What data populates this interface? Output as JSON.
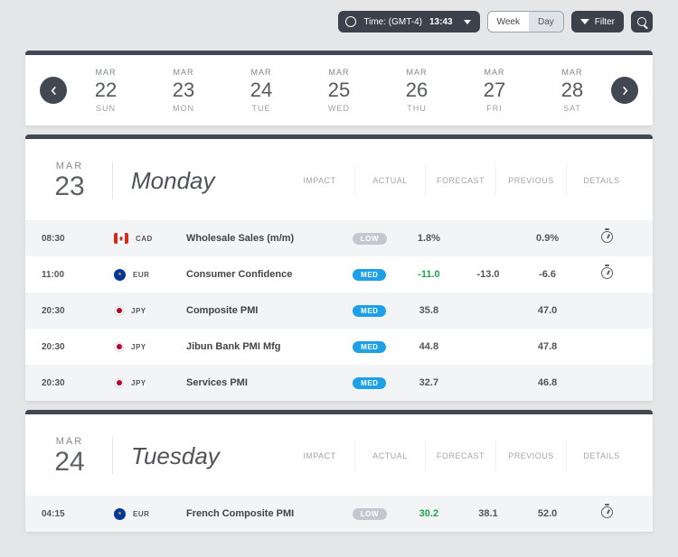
{
  "topbar": {
    "time_label": "Time: (GMT-4)",
    "time_value": "13:43",
    "toggle_week": "Week",
    "toggle_day": "Day",
    "filter_label": "Filter"
  },
  "datestrip": {
    "days": [
      {
        "month": "MAR",
        "num": "22",
        "dow": "SUN"
      },
      {
        "month": "MAR",
        "num": "23",
        "dow": "MON"
      },
      {
        "month": "MAR",
        "num": "24",
        "dow": "TUE"
      },
      {
        "month": "MAR",
        "num": "25",
        "dow": "WED"
      },
      {
        "month": "MAR",
        "num": "26",
        "dow": "THU"
      },
      {
        "month": "MAR",
        "num": "27",
        "dow": "FRI"
      },
      {
        "month": "MAR",
        "num": "28",
        "dow": "SAT"
      }
    ]
  },
  "columns": {
    "impact": "IMPACT",
    "actual": "ACTUAL",
    "forecast": "FORECAST",
    "previous": "PREVIOUS",
    "details": "DETAILS"
  },
  "sections": [
    {
      "month": "MAR",
      "num": "23",
      "name": "Monday",
      "rows": [
        {
          "time": "08:30",
          "flag": "ca",
          "cc": "CAD",
          "event": "Wholesale Sales (m/m)",
          "impact": "LOW",
          "actual": "1.8%",
          "actual_color": "",
          "forecast": "",
          "previous": "0.9%",
          "has_details": true
        },
        {
          "time": "11:00",
          "flag": "eu",
          "cc": "EUR",
          "event": "Consumer Confidence",
          "impact": "MED",
          "actual": "-11.0",
          "actual_color": "green",
          "forecast": "-13.0",
          "previous": "-6.6",
          "has_details": true
        },
        {
          "time": "20:30",
          "flag": "jp",
          "cc": "JPY",
          "event": "Composite PMI",
          "impact": "MED",
          "actual": "35.8",
          "actual_color": "",
          "forecast": "",
          "previous": "47.0",
          "has_details": false
        },
        {
          "time": "20:30",
          "flag": "jp",
          "cc": "JPY",
          "event": "Jibun Bank PMI Mfg",
          "impact": "MED",
          "actual": "44.8",
          "actual_color": "",
          "forecast": "",
          "previous": "47.8",
          "has_details": false
        },
        {
          "time": "20:30",
          "flag": "jp",
          "cc": "JPY",
          "event": "Services PMI",
          "impact": "MED",
          "actual": "32.7",
          "actual_color": "",
          "forecast": "",
          "previous": "46.8",
          "has_details": false
        }
      ]
    },
    {
      "month": "MAR",
      "num": "24",
      "name": "Tuesday",
      "rows": [
        {
          "time": "04:15",
          "flag": "eu",
          "cc": "EUR",
          "event": "French Composite PMI",
          "impact": "LOW",
          "actual": "30.2",
          "actual_color": "green",
          "forecast": "38.1",
          "previous": "52.0",
          "has_details": true
        }
      ]
    }
  ]
}
